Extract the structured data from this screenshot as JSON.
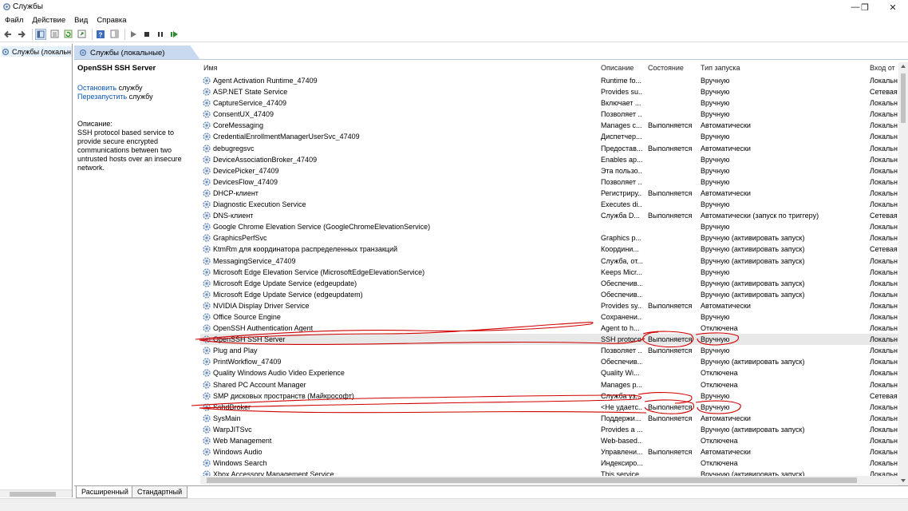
{
  "window": {
    "title": "Службы",
    "minimize": "—",
    "maximize": "❐",
    "close": "✕"
  },
  "menu": [
    "Файл",
    "Действие",
    "Вид",
    "Справка"
  ],
  "tree": {
    "item": "Службы (локальн"
  },
  "header": {
    "title": "Службы (локальные)"
  },
  "details": {
    "service_name": "OpenSSH SSH Server",
    "stop_link": "Остановить",
    "stop_suffix": " службу",
    "restart_link": "Перезапустить",
    "restart_suffix": " службу",
    "description_label": "Описание:",
    "description": "SSH protocol based service to provide secure encrypted communications between two untrusted hosts over an insecure network."
  },
  "columns": {
    "name": "Имя",
    "desc": "Описание",
    "state": "Состояние",
    "start": "Тип запуска",
    "logon": "Вход от"
  },
  "services": [
    {
      "name": "Agent Activation Runtime_47409",
      "desc": "Runtime fo...",
      "state": "",
      "start": "Вручную",
      "logon": "Локальн"
    },
    {
      "name": "ASP.NET State Service",
      "desc": "Provides su...",
      "state": "",
      "start": "Вручную",
      "logon": "Сетевая"
    },
    {
      "name": "CaptureService_47409",
      "desc": "Включает ...",
      "state": "",
      "start": "Вручную",
      "logon": "Локальн"
    },
    {
      "name": "ConsentUX_47409",
      "desc": "Позволяет ...",
      "state": "",
      "start": "Вручную",
      "logon": "Локальн"
    },
    {
      "name": "CoreMessaging",
      "desc": "Manages c...",
      "state": "Выполняется",
      "start": "Автоматически",
      "logon": "Локальн"
    },
    {
      "name": "CredentialEnrollmentManagerUserSvc_47409",
      "desc": "Диспетчер...",
      "state": "",
      "start": "Вручную",
      "logon": "Локальн"
    },
    {
      "name": "debugregsvc",
      "desc": "Предостав...",
      "state": "Выполняется",
      "start": "Автоматически",
      "logon": "Локальн"
    },
    {
      "name": "DeviceAssociationBroker_47409",
      "desc": "Enables ap...",
      "state": "",
      "start": "Вручную",
      "logon": "Локальн"
    },
    {
      "name": "DevicePicker_47409",
      "desc": "Эта пользо...",
      "state": "",
      "start": "Вручную",
      "logon": "Локальн"
    },
    {
      "name": "DevicesFlow_47409",
      "desc": "Позволяет ...",
      "state": "",
      "start": "Вручную",
      "logon": "Локальн"
    },
    {
      "name": "DHCP-клиент",
      "desc": "Регистриру...",
      "state": "Выполняется",
      "start": "Автоматически",
      "logon": "Локальн"
    },
    {
      "name": "Diagnostic Execution Service",
      "desc": "Executes di...",
      "state": "",
      "start": "Вручную",
      "logon": "Локальн"
    },
    {
      "name": "DNS-клиент",
      "desc": "Служба D...",
      "state": "Выполняется",
      "start": "Автоматически (запуск по триггеру)",
      "logon": "Сетевая"
    },
    {
      "name": "Google Chrome Elevation Service (GoogleChromeElevationService)",
      "desc": "",
      "state": "",
      "start": "Вручную",
      "logon": "Локальн"
    },
    {
      "name": "GraphicsPerfSvc",
      "desc": "Graphics p...",
      "state": "",
      "start": "Вручную (активировать запуск)",
      "logon": "Локальн"
    },
    {
      "name": "KtmRm для координатора распределенных транзакций",
      "desc": "Координи...",
      "state": "",
      "start": "Вручную (активировать запуск)",
      "logon": "Сетевая"
    },
    {
      "name": "MessagingService_47409",
      "desc": "Служба, от...",
      "state": "",
      "start": "Вручную (активировать запуск)",
      "logon": "Локальн"
    },
    {
      "name": "Microsoft Edge Elevation Service (MicrosoftEdgeElevationService)",
      "desc": "Keeps Micr...",
      "state": "",
      "start": "Вручную",
      "logon": "Локальн"
    },
    {
      "name": "Microsoft Edge Update Service (edgeupdate)",
      "desc": "Обеспечив...",
      "state": "",
      "start": "Вручную (активировать запуск)",
      "logon": "Локальн"
    },
    {
      "name": "Microsoft Edge Update Service (edgeupdatem)",
      "desc": "Обеспечив...",
      "state": "",
      "start": "Вручную (активировать запуск)",
      "logon": "Локальн"
    },
    {
      "name": "NVIDIA Display Driver Service",
      "desc": "Provides sy...",
      "state": "Выполняется",
      "start": "Автоматически",
      "logon": "Локальн"
    },
    {
      "name": "Office  Source Engine",
      "desc": "Сохранени...",
      "state": "",
      "start": "Вручную",
      "logon": "Локальн"
    },
    {
      "name": "OpenSSH Authentication Agent",
      "desc": "Agent to h...",
      "state": "",
      "start": "Отключена",
      "logon": "Локальн"
    },
    {
      "name": "OpenSSH SSH Server",
      "desc": "SSH protoco...",
      "state": "Выполняется",
      "start": "Вручную",
      "logon": "Локальн",
      "selected": true
    },
    {
      "name": "Plug and Play",
      "desc": "Позволяет ...",
      "state": "Выполняется",
      "start": "Вручную",
      "logon": "Локальн"
    },
    {
      "name": "PrintWorkflow_47409",
      "desc": "Обеспечив...",
      "state": "",
      "start": "Вручную (активировать запуск)",
      "logon": "Локальн"
    },
    {
      "name": "Quality Windows Audio Video Experience",
      "desc": "Quality Wi...",
      "state": "",
      "start": "Отключена",
      "logon": "Локальн"
    },
    {
      "name": "Shared PC Account Manager",
      "desc": "Manages p...",
      "state": "",
      "start": "Отключена",
      "logon": "Локальн"
    },
    {
      "name": "SMP дисковых пространств (Майкрософт)",
      "desc": "Служба уз...",
      "state": "",
      "start": "Вручную",
      "logon": "Сетевая"
    },
    {
      "name": "SshdBroker",
      "desc": "<Не удаетс...",
      "state": "Выполняется",
      "start": "Вручную",
      "logon": "Локальн"
    },
    {
      "name": "SysMain",
      "desc": "Поддержи...",
      "state": "Выполняется",
      "start": "Автоматически",
      "logon": "Локальн"
    },
    {
      "name": "WarpJITSvc",
      "desc": "Provides a ...",
      "state": "",
      "start": "Вручную (активировать запуск)",
      "logon": "Локальн"
    },
    {
      "name": "Web Management",
      "desc": "Web-based...",
      "state": "",
      "start": "Отключена",
      "logon": "Локальн"
    },
    {
      "name": "Windows Audio",
      "desc": "Управлени...",
      "state": "Выполняется",
      "start": "Автоматически",
      "logon": "Локальн"
    },
    {
      "name": "Windows Search",
      "desc": "Индексиро...",
      "state": "",
      "start": "Отключена",
      "logon": "Локальн"
    },
    {
      "name": "Xbox Accessory Management Service",
      "desc": "This service ...",
      "state": "",
      "start": "Вручную (активировать запуск)",
      "logon": "Локальн"
    }
  ],
  "tabs": [
    "Расширенный",
    "Стандартный"
  ],
  "colors": {
    "accent": "#0b55b8",
    "header_band": "#c9d9ef",
    "annotation": "#d10000"
  }
}
